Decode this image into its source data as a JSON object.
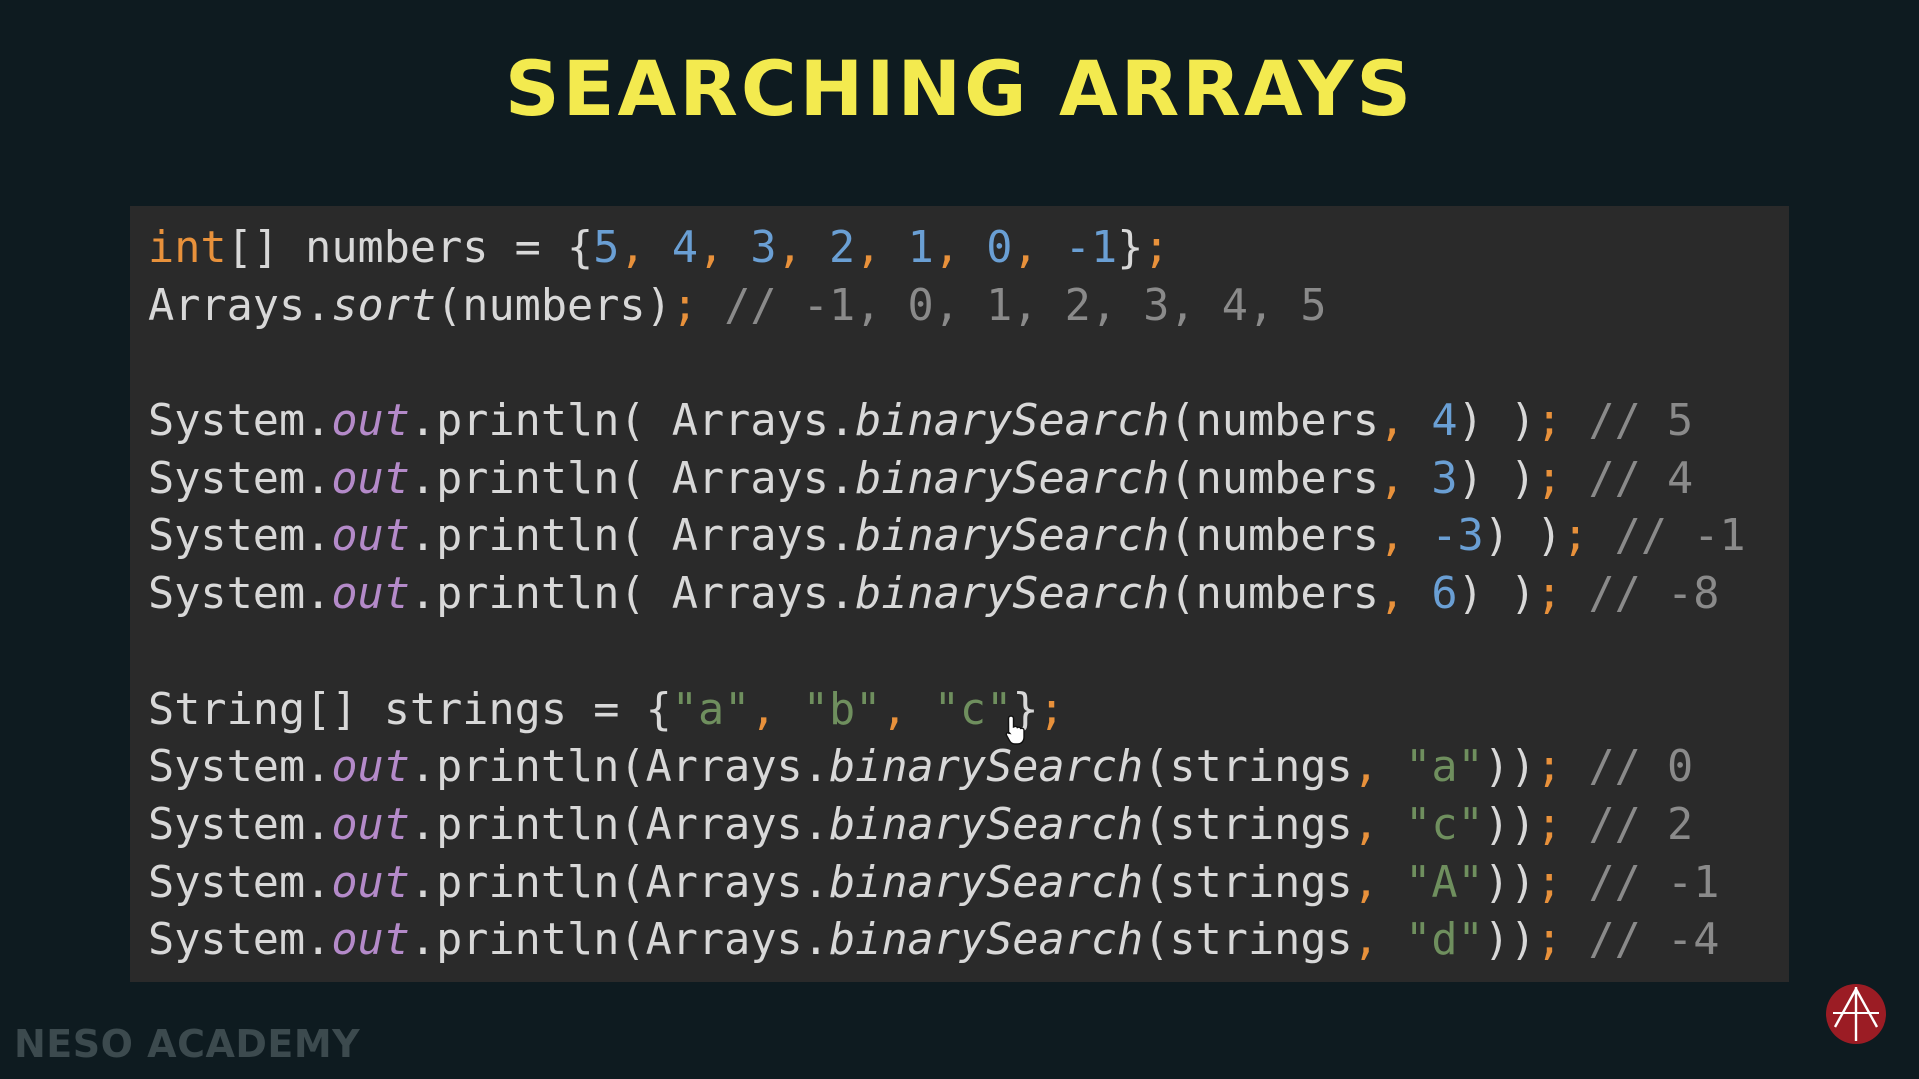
{
  "slide": {
    "title": "SEARCHING ARRAYS",
    "watermark": "NESO ACADEMY",
    "logo_icon": "neso-academy-logo-icon",
    "cursor_icon": "hand-pointer-cursor-icon"
  },
  "colors": {
    "background": "#0e1b20",
    "code_panel": "#2a2a2a",
    "title": "#f3ea4f",
    "keyword": "#e8913b",
    "number": "#6a9fd4",
    "comment": "#8a8a8a",
    "string": "#6f8f5e",
    "static_field": "#b48ac9",
    "plain": "#d8d8d8",
    "logo": "#9b1c24"
  },
  "code": {
    "l1": {
      "kw": "int",
      "a": "[] numbers = {",
      "n1": "5",
      "s1": ", ",
      "n2": "4",
      "s2": ", ",
      "n3": "3",
      "s3": ", ",
      "n4": "2",
      "s4": ", ",
      "n5": "1",
      "s5": ", ",
      "n6": "0",
      "s6": ", ",
      "n7": "-1",
      "b": "}",
      "semi": ";"
    },
    "l2": {
      "a": "Arrays.",
      "method": "sort",
      "b": "(numbers)",
      "semi": ";",
      "comment": " // -1, 0, 1, 2, 3, 4, 5"
    },
    "l3": {
      "a": "System.",
      "out": "out",
      "b": ".println( Arrays.",
      "method": "binarySearch",
      "c": "(numbers",
      "comma": ", ",
      "num": "4",
      "d": ") )",
      "semi": ";",
      "comment": " // 5"
    },
    "l4": {
      "a": "System.",
      "out": "out",
      "b": ".println( Arrays.",
      "method": "binarySearch",
      "c": "(numbers",
      "comma": ", ",
      "num": "3",
      "d": ") )",
      "semi": ";",
      "comment": " // 4"
    },
    "l5": {
      "a": "System.",
      "out": "out",
      "b": ".println( Arrays.",
      "method": "binarySearch",
      "c": "(numbers",
      "comma": ", ",
      "num": "-3",
      "d": ") )",
      "semi": ";",
      "comment": " // -1"
    },
    "l6": {
      "a": "System.",
      "out": "out",
      "b": ".println( Arrays.",
      "method": "binarySearch",
      "c": "(numbers",
      "comma": ", ",
      "num": "6",
      "d": ") )",
      "semi": ";",
      "comment": " // -8"
    },
    "l7": {
      "a": "String[] strings = {",
      "str1": "\"a\"",
      "s1": ", ",
      "str2": "\"b\"",
      "s2": ", ",
      "str3": "\"c\"",
      "b": "}",
      "semi": ";"
    },
    "l8": {
      "a": "System.",
      "out": "out",
      "b": ".println(Arrays.",
      "method": "binarySearch",
      "c": "(strings",
      "comma": ", ",
      "str": "\"a\"",
      "d": "))",
      "semi": ";",
      "comment": " // 0"
    },
    "l9": {
      "a": "System.",
      "out": "out",
      "b": ".println(Arrays.",
      "method": "binarySearch",
      "c": "(strings",
      "comma": ", ",
      "str": "\"c\"",
      "d": "))",
      "semi": ";",
      "comment": " // 2"
    },
    "l10": {
      "a": "System.",
      "out": "out",
      "b": ".println(Arrays.",
      "method": "binarySearch",
      "c": "(strings",
      "comma": ", ",
      "str": "\"A\"",
      "d": "))",
      "semi": ";",
      "comment": " // -1"
    },
    "l11": {
      "a": "System.",
      "out": "out",
      "b": ".println(Arrays.",
      "method": "binarySearch",
      "c": "(strings",
      "comma": ", ",
      "str": "\"d\"",
      "d": "))",
      "semi": ";",
      "comment": " // -4"
    }
  }
}
